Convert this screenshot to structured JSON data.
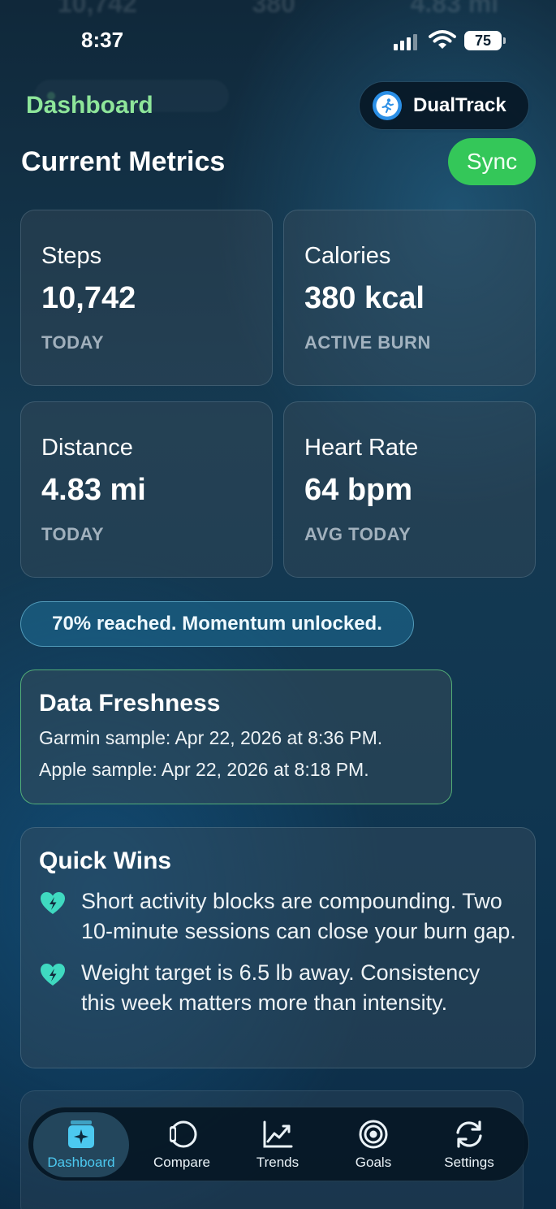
{
  "status_bar": {
    "time": "8:37",
    "battery": "75"
  },
  "header": {
    "title": "Dashboard",
    "brand": "DualTrack"
  },
  "section": {
    "title": "Current Metrics",
    "sync_label": "Sync"
  },
  "metrics": [
    {
      "label": "Steps",
      "value": "10,742",
      "sub": "TODAY"
    },
    {
      "label": "Calories",
      "value": "380 kcal",
      "sub": "ACTIVE BURN"
    },
    {
      "label": "Distance",
      "value": "4.83 mi",
      "sub": "TODAY"
    },
    {
      "label": "Heart Rate",
      "value": "64 bpm",
      "sub": "AVG TODAY"
    }
  ],
  "banner": "70% reached. Momentum unlocked.",
  "freshness": {
    "title": "Data Freshness",
    "garmin": "Garmin sample: Apr 22, 2026 at 8:36 PM.",
    "apple": "Apple sample: Apr 22, 2026 at 8:18 PM."
  },
  "quick_wins": {
    "title": "Quick Wins",
    "items": [
      "Short activity blocks are compounding. Two 10-minute sessions can close your burn gap.",
      "Weight target is 6.5 lb away. Consistency this week matters more than intensity."
    ]
  },
  "tabs": [
    {
      "label": "Dashboard",
      "icon": "sparkle-card-icon"
    },
    {
      "label": "Compare",
      "icon": "watch-icon"
    },
    {
      "label": "Trends",
      "icon": "trend-chart-icon"
    },
    {
      "label": "Goals",
      "icon": "target-icon"
    },
    {
      "label": "Settings",
      "icon": "sync-arrows-icon"
    }
  ],
  "colors": {
    "accent_green": "#34c759",
    "tab_active": "#4cc9f0",
    "header_green": "#8ee69a"
  }
}
